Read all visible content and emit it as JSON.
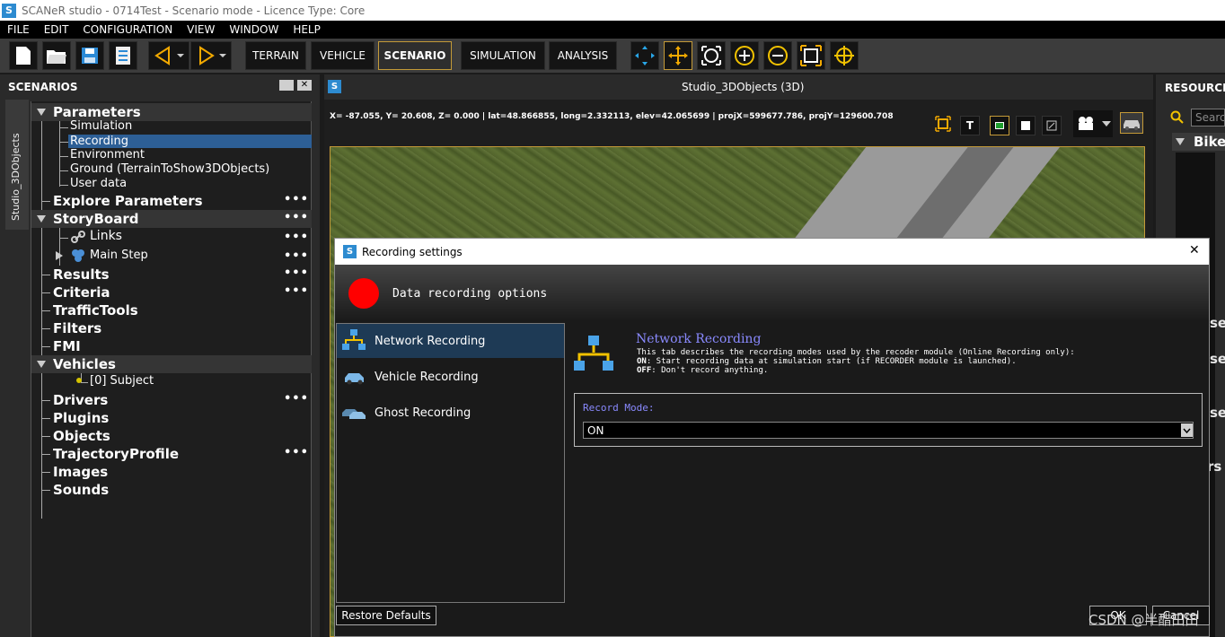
{
  "window": {
    "title": "SCANeR studio - 0714Test - Scenario mode - Licence Type: Core"
  },
  "menu": [
    "FILE",
    "EDIT",
    "CONFIGURATION",
    "VIEW",
    "WINDOW",
    "HELP"
  ],
  "toolbar": {
    "modes": [
      "TERRAIN",
      "VEHICLE",
      "SCENARIO",
      "SIMULATION",
      "ANALYSIS"
    ]
  },
  "left_panel": {
    "title": "SCENARIOS",
    "vertical_tab": "Studio_3DObjects",
    "more": "•••",
    "tree": {
      "parameters": "Parameters",
      "param_children": [
        "Simulation",
        "Recording",
        "Environment",
        "Ground (TerrainToShow3DObjects)",
        "User data"
      ],
      "explore": "Explore Parameters",
      "storyboard": "StoryBoard",
      "links": "Links",
      "main_step": "Main Step",
      "results": "Results",
      "criteria": "Criteria",
      "traffictools": "TrafficTools",
      "filters": "Filters",
      "fmi": "FMI",
      "vehicles": "Vehicles",
      "subject": "[0] Subject",
      "drivers": "Drivers",
      "plugins": "Plugins",
      "objects": "Objects",
      "trajectory": "TrajectoryProfile",
      "images": "Images",
      "sounds": "Sounds"
    }
  },
  "center": {
    "title": "Studio_3DObjects (3D)",
    "coords": "X= -87.055, Y=  20.608, Z=   0.000 | lat=48.866855, long=2.332113, elev=42.065699 | projX=599677.786, projY=129600.708",
    "t_button": "T"
  },
  "right_panel": {
    "title": "RESOURCE",
    "search_placeholder": "Searc",
    "bike": "Bike",
    "partial_labels": [
      "se",
      "se",
      "se",
      "rs"
    ]
  },
  "dialog": {
    "title": "Recording settings",
    "close": "✕",
    "banner": "Data recording options",
    "nav": [
      "Network Recording",
      "Vehicle Recording",
      "Ghost Recording"
    ],
    "section_title": "Network Recording",
    "desc_line1": "This tab describes the recording modes used by the recoder module (Online Recording only):",
    "desc_on_key": "ON",
    "desc_on_text": ": Start recording data at simulation start (if RECORDER module is launched).",
    "desc_off_key": "OFF",
    "desc_off_text": ": Don't record anything.",
    "record_mode_label": "Record Mode:",
    "record_mode_value": "ON",
    "restore": "Restore Defaults",
    "ok": "OK",
    "cancel": "Cancel"
  },
  "watermark": "CSDN @半醋田田",
  "colors": {
    "accent": "#c49a38",
    "selection": "#2d5f96",
    "record_red": "#ff0000",
    "link_blue": "#8a8aff"
  }
}
